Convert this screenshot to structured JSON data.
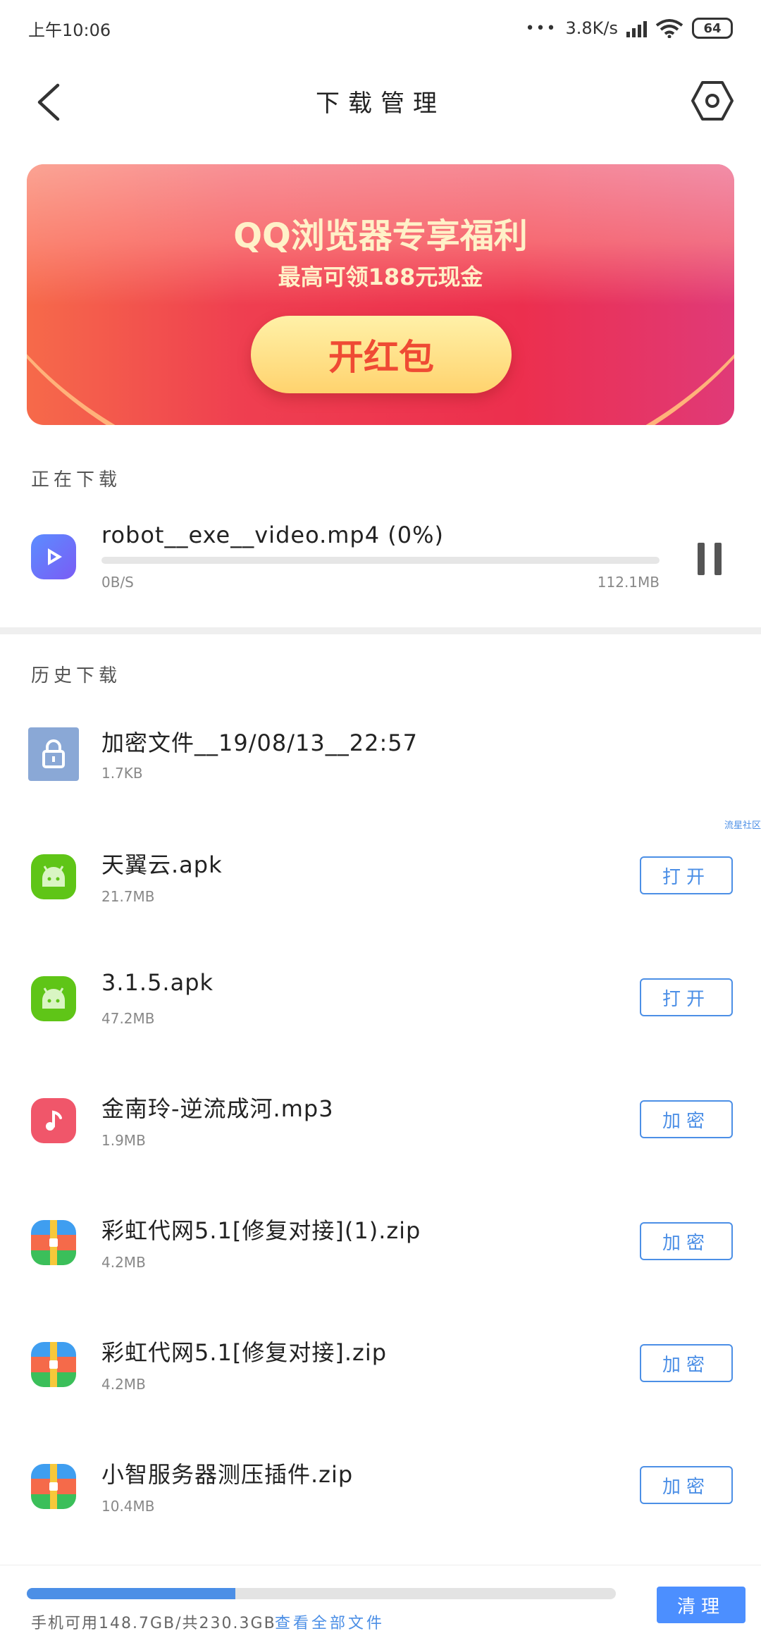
{
  "status_bar": {
    "time": "上午10:06",
    "dots": "•••",
    "network_speed": "3.8K/s",
    "battery": "64"
  },
  "header": {
    "title": "下载管理",
    "back_icon": "back-chevron-icon",
    "settings_icon": "hexagon-gear-icon"
  },
  "banner": {
    "title": "QQ浏览器专享福利",
    "subtitle": "最高可领188元现金",
    "button_label": "开红包"
  },
  "downloading": {
    "section_label": "正在下载",
    "item": {
      "name": "robot__exe__video.mp4 (0%)",
      "speed": "0B/S",
      "total_size": "112.1MB",
      "progress": 0,
      "icon": "video-play-icon"
    }
  },
  "history": {
    "section_label": "历史下载",
    "items": [
      {
        "name": "加密文件__19/08/13__22:57",
        "size": "1.7KB",
        "button": "",
        "icon": "encrypted-file-icon"
      },
      {
        "name": "天翼云.apk",
        "size": "21.7MB",
        "button": "打开",
        "icon": "android-apk-icon"
      },
      {
        "name": "3.1.5.apk",
        "size": "47.2MB",
        "button": "打开",
        "icon": "android-apk-icon"
      },
      {
        "name": "金南玲-逆流成河.mp3",
        "size": "1.9MB",
        "button": "加密",
        "icon": "music-note-icon"
      },
      {
        "name": "彩虹代网5.1[修复对接](1).zip",
        "size": "4.2MB",
        "button": "加密",
        "icon": "zip-archive-icon"
      },
      {
        "name": "彩虹代网5.1[修复对接].zip",
        "size": "4.2MB",
        "button": "加密",
        "icon": "zip-archive-icon"
      },
      {
        "name": "小智服务器测压插件.zip",
        "size": "10.4MB",
        "button": "加密",
        "icon": "zip-archive-icon"
      }
    ]
  },
  "watermark": "流星社区",
  "storage": {
    "text": "手机可用148.7GB/共230.3GB",
    "used_fraction": 0.354,
    "view_all_label": "查看全部文件",
    "clean_button": "清理"
  },
  "colors": {
    "accent": "#4c8fe6",
    "banner_red": "#ec2f4e",
    "banner_button": "#ffd36e"
  }
}
